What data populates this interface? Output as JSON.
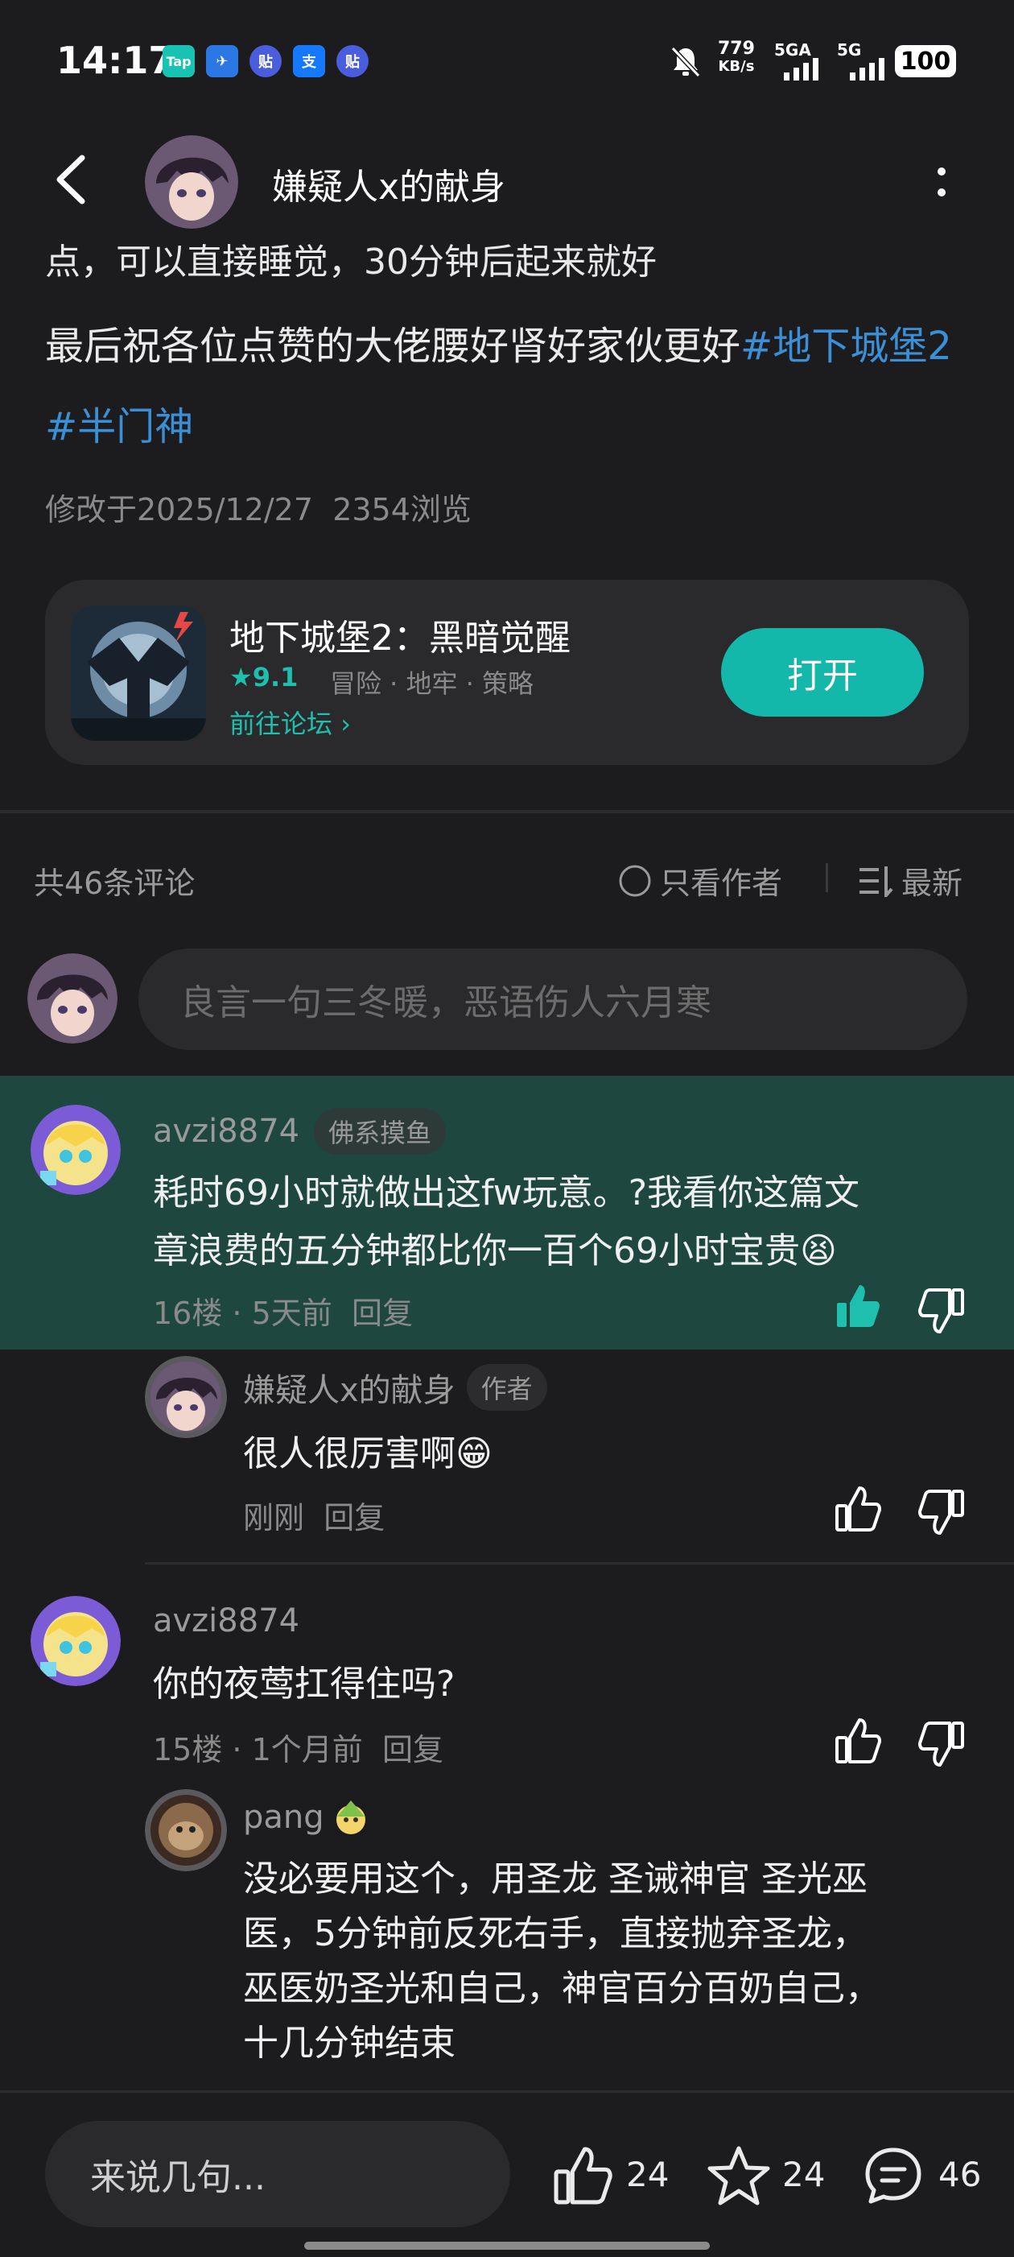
{
  "status_bar": {
    "time": "14:17",
    "app_icons": [
      {
        "label": "Tap",
        "color": "#18c3b4"
      },
      {
        "label": "✈",
        "color": "#2b78e4"
      },
      {
        "label": "贴",
        "color": "#4a5ddc"
      },
      {
        "label": "支",
        "color": "#1677ff"
      },
      {
        "label": "贴",
        "color": "#4a5ddc"
      }
    ],
    "net_speed": "779",
    "net_unit": "KB/s",
    "signal1": "5GA",
    "signal2": "5G",
    "battery": "100"
  },
  "header": {
    "title": "嫌疑人x的献身"
  },
  "post": {
    "cut_line": "点，可以直接睡觉，30分钟后起来就好",
    "body_prefix": "最后祝各位点赞的大佬腰好肾好家伙更好",
    "tag1": "#地下城堡2",
    "tag2": "#半门神",
    "modified": "修改于2025/12/27",
    "views": "2354浏览"
  },
  "game_card": {
    "name": "地下城堡2：黑暗觉醒",
    "rating": "9.1",
    "genres": "冒险 · 地牢 · 策略",
    "forum_link": "前往论坛",
    "open_button": "打开"
  },
  "comments_bar": {
    "count": "共46条评论",
    "only_author": "只看作者",
    "sort": "最新",
    "input_placeholder": "良言一句三冬暖，恶语伤人六月寒"
  },
  "comments": [
    {
      "user": "avzi8874",
      "badge": "佛系摸鱼",
      "text": "耗时69小时就做出这fw玩意。?我看你这篇文章浪费的五分钟都比你一百个69小时宝贵😫",
      "line1": "耗时69小时就做出这fw玩意。?我看你这篇文",
      "line2": "章浪费的五分钟都比你一百个69小时宝贵😫",
      "floor": "16楼 · 5天前",
      "reply": "回复"
    },
    {
      "user": "嫌疑人x的献身",
      "badge": "作者",
      "text": "很人很厉害啊😁",
      "time": "刚刚",
      "reply": "回复"
    },
    {
      "user": "avzi8874",
      "text": "你的夜莺扛得住吗?",
      "floor": "15楼 · 1个月前",
      "reply": "回复"
    },
    {
      "user": "pang",
      "lines": [
        "没必要用这个，用圣龙 圣诫神官 圣光巫",
        "医，5分钟前反死右手，直接抛弃圣龙，",
        "巫医奶圣光和自己，神官百分百奶自己，",
        "十几分钟结束"
      ]
    }
  ],
  "bottom_bar": {
    "input_placeholder": "来说几句...",
    "likes": "24",
    "favorites": "24",
    "comments": "46"
  }
}
